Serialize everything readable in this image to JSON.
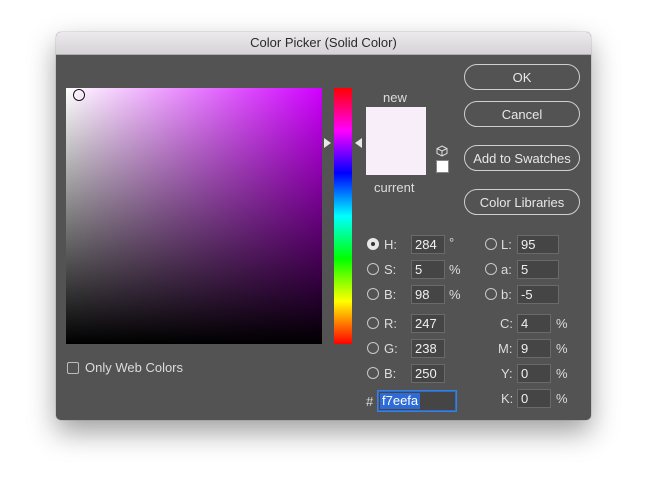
{
  "window": {
    "title": "Color Picker (Solid Color)"
  },
  "buttons": {
    "ok": "OK",
    "cancel": "Cancel",
    "add_to_swatches": "Add to Swatches",
    "color_libraries": "Color Libraries"
  },
  "preview": {
    "new_label": "new",
    "current_label": "current",
    "new_color": "#f7eefa"
  },
  "only_web_colors": {
    "label": "Only Web Colors",
    "checked": false
  },
  "hsb": {
    "h": {
      "label": "H:",
      "value": "284",
      "unit": "°",
      "selected": true
    },
    "s": {
      "label": "S:",
      "value": "5",
      "unit": "%"
    },
    "b": {
      "label": "B:",
      "value": "98",
      "unit": "%"
    }
  },
  "lab": {
    "l": {
      "label": "L:",
      "value": "95"
    },
    "a": {
      "label": "a:",
      "value": "5"
    },
    "b": {
      "label": "b:",
      "value": "-5"
    }
  },
  "rgb": {
    "r": {
      "label": "R:",
      "value": "247"
    },
    "g": {
      "label": "G:",
      "value": "238"
    },
    "b": {
      "label": "B:",
      "value": "250"
    }
  },
  "cmyk": {
    "c": {
      "label": "C:",
      "value": "4",
      "unit": "%"
    },
    "m": {
      "label": "M:",
      "value": "9",
      "unit": "%"
    },
    "y": {
      "label": "Y:",
      "value": "0",
      "unit": "%"
    },
    "k": {
      "label": "K:",
      "value": "0",
      "unit": "%"
    }
  },
  "hex": {
    "prefix": "#",
    "value": "f7eefa"
  },
  "colors": {
    "hue_color": "#d000ff",
    "dialog_bg": "#535353"
  }
}
